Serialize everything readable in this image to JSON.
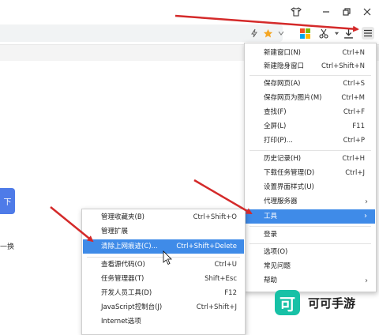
{
  "titlebar": {
    "icons": [
      "shirt-icon",
      "minimize-icon",
      "restore-icon",
      "close-icon"
    ]
  },
  "toolbar": {
    "icons": [
      "lightning-icon",
      "star-icon",
      "apps-icon",
      "scissors-icon",
      "download-icon",
      "menu-icon"
    ]
  },
  "page": {
    "blue_button_label": "下",
    "side_text": "一换"
  },
  "main_menu": {
    "items": [
      {
        "label": "新建窗口(N)",
        "shortcut": "Ctrl+N"
      },
      {
        "label": "新建隐身窗口",
        "shortcut": "Ctrl+Shift+N"
      },
      {
        "label": "保存网页(A)",
        "shortcut": "Ctrl+S"
      },
      {
        "label": "保存网页为图片(M)",
        "shortcut": "Ctrl+M"
      },
      {
        "label": "查找(F)",
        "shortcut": "Ctrl+F"
      },
      {
        "label": "全屏(L)",
        "shortcut": "F11"
      },
      {
        "label": "打印(P)...",
        "shortcut": "Ctrl+P"
      },
      {
        "label": "历史记录(H)",
        "shortcut": "Ctrl+H"
      },
      {
        "label": "下载任务管理(D)",
        "shortcut": "Ctrl+J"
      },
      {
        "label": "设置界面样式(U)",
        "shortcut": ""
      },
      {
        "label": "代理服务器",
        "shortcut": ""
      },
      {
        "label": "工具",
        "shortcut": ""
      },
      {
        "label": "登录",
        "shortcut": ""
      },
      {
        "label": "选项(O)",
        "shortcut": ""
      },
      {
        "label": "常见问题",
        "shortcut": ""
      },
      {
        "label": "帮助",
        "shortcut": ""
      }
    ]
  },
  "sub_menu": {
    "items": [
      {
        "label": "管理收藏夹(B)",
        "shortcut": "Ctrl+Shift+O"
      },
      {
        "label": "管理扩展",
        "shortcut": ""
      },
      {
        "label": "清除上网痕迹(C)...",
        "shortcut": "Ctrl+Shift+Delete"
      },
      {
        "label": "查看源代码(O)",
        "shortcut": "Ctrl+U"
      },
      {
        "label": "任务管理器(T)",
        "shortcut": "Shift+Esc"
      },
      {
        "label": "开发人员工具(D)",
        "shortcut": "F12"
      },
      {
        "label": "JavaScript控制台(J)",
        "shortcut": "Ctrl+Shift+J"
      },
      {
        "label": "Internet选项",
        "shortcut": ""
      }
    ]
  },
  "watermark": {
    "logo_char": "可",
    "text": "可可手游"
  },
  "colors": {
    "highlight": "#3f8be8",
    "arrow": "#d42a2a",
    "watermark": "#17c1a6"
  }
}
